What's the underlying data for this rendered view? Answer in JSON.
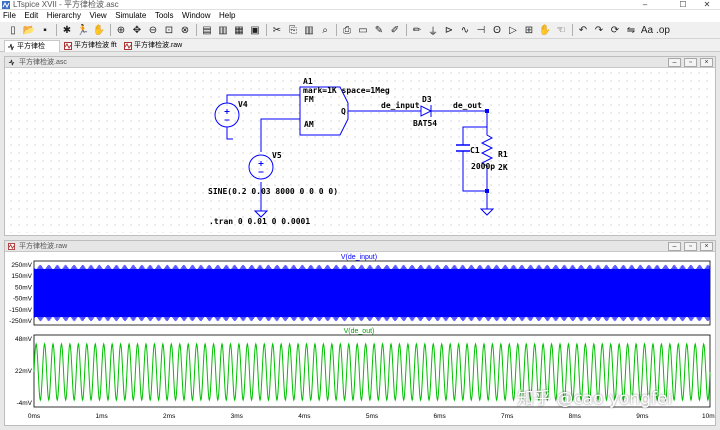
{
  "window": {
    "title": "LTspice XVII - 平方律检波.asc",
    "controls": [
      "–",
      "☐",
      "✕"
    ]
  },
  "menu": [
    "File",
    "Edit",
    "Hierarchy",
    "View",
    "Simulate",
    "Tools",
    "Window",
    "Help"
  ],
  "toolbar": {
    "icons": [
      "new-icon",
      "open-icon",
      "save-icon",
      "sep",
      "control-panel-icon",
      "run-icon",
      "halt-icon",
      "sep",
      "zoom-in-icon",
      "pan-icon",
      "zoom-out-icon",
      "zoom-fit-icon",
      "zoom-cancel-icon",
      "sep",
      "autoscale-icon",
      "tile-horizontal-icon",
      "tile-vertical-icon",
      "close-window-icon",
      "sep",
      "cut-icon",
      "copy-icon",
      "paste-icon",
      "find-icon",
      "sep",
      "print-icon",
      "print-preview-icon",
      "undo-icon",
      "redo-icon",
      "sep",
      "wire-icon",
      "ground-icon",
      "label-icon",
      "resistor-icon",
      "capacitor-icon",
      "inductor-icon",
      "diode-icon",
      "component-icon",
      "move-icon",
      "drag-icon",
      "sep",
      "undo2-icon",
      "redo2-icon",
      "rotate-icon",
      "mirror-icon",
      "text-icon",
      "spice-directive-icon"
    ]
  },
  "tabs": [
    {
      "label": "平方律检波.asc"
    },
    {
      "label": "平方律检波 fft"
    },
    {
      "label": "平方律检波.raw"
    }
  ],
  "schematic_window": {
    "title": "平方律检波.asc",
    "labels": {
      "a1": "A1",
      "a1_params": "mark=1K space=1Meg",
      "fm": "FM",
      "am": "AM",
      "q": "Q",
      "v4": "V4",
      "v5": "V5",
      "sine": "SINE(0.2 0.03 8000 0 0 0 0)",
      "tran": ".tran 0 0.01 0 0.0001",
      "de_input": "de_input",
      "d3": "D3",
      "bat54": "BAT54",
      "de_out": "de_out",
      "c1": "C1",
      "c1_val": "2000p",
      "r1": "R1",
      "r1_val": "2K"
    }
  },
  "waveform_window": {
    "title": "平方律检波.raw",
    "pane1": {
      "trace": "V(de_input)",
      "color": "#0000ff",
      "yticks": [
        "250mV",
        "150mV",
        "50mV",
        "-50mV",
        "-150mV",
        "-250mV"
      ]
    },
    "pane2": {
      "trace": "V(de_out)",
      "color": "#00c000",
      "yticks": [
        "48mV",
        "22mV",
        "-4mV"
      ]
    },
    "xticks": [
      "0ms",
      "1ms",
      "2ms",
      "3ms",
      "4ms",
      "5ms",
      "6ms",
      "7ms",
      "8ms",
      "9ms",
      "10ms"
    ]
  },
  "watermark": "知乎 @cao yongfei"
}
